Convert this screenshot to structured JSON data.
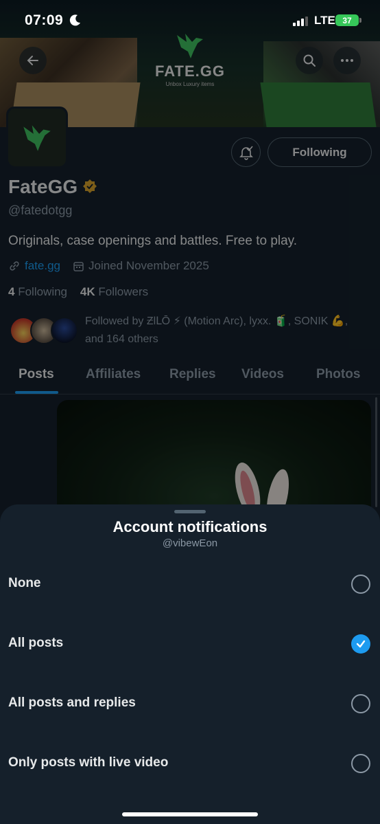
{
  "status_bar": {
    "time": "07:09",
    "network": "LTE",
    "battery": "37"
  },
  "banner": {
    "brand": "FATE.GG",
    "tagline": "Unbox Luxury items"
  },
  "profile": {
    "display_name": "FateGG",
    "handle": "@fatedotgg",
    "bio": "Originals, case openings and battles. Free to play.",
    "website": "fate.gg",
    "joined": "Joined November 2025",
    "following_count": "4",
    "following_label": "Following",
    "followers_count": "4K",
    "followers_label": "Followers",
    "follow_button_label": "Following",
    "followed_by": "Followed by ƵƖԼŌ ⚡ (Motion Arc), lyxx. 🧃, SONIK 💪, and 164 others"
  },
  "tabs": [
    "Posts",
    "Affiliates",
    "Replies",
    "Videos",
    "Photos"
  ],
  "sheet": {
    "title": "Account notifications",
    "subtitle": "@vibewEon",
    "options": [
      "None",
      "All posts",
      "All posts and replies",
      "Only posts with live video"
    ],
    "selected": "All posts"
  },
  "colors": {
    "accent": "#1d9bf0",
    "background": "#15202b",
    "brand_green": "#3aa35a",
    "verified_gold": "#d6a12b"
  }
}
